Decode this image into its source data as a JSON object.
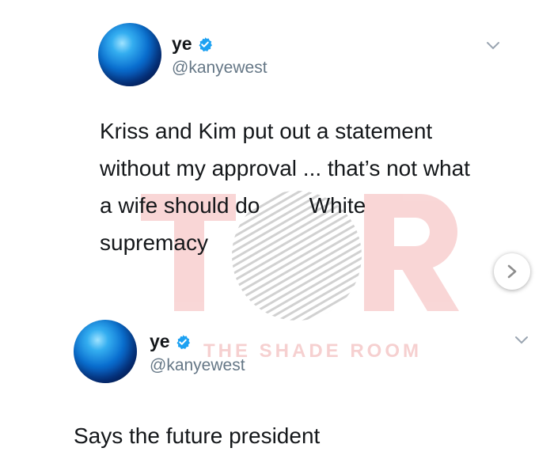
{
  "tweets": [
    {
      "name": "ye",
      "handle": "@kanyewest",
      "text": "Kriss and Kim put out a statement without my approval ... that’s not what a wife should do        White supremacy",
      "verified": true
    },
    {
      "name": "ye",
      "handle": "@kanyewest",
      "text": "Says the future president",
      "verified": true
    }
  ],
  "watermark": {
    "logo": "TSR",
    "text": "THE SHADE ROOM"
  },
  "icons": {
    "verified": "verified-badge-icon",
    "menu": "chevron-down-icon",
    "next": "chevron-right-icon"
  },
  "colors": {
    "verified": "#1da1f2",
    "handle": "#657786",
    "watermark": "#e87b7b"
  }
}
